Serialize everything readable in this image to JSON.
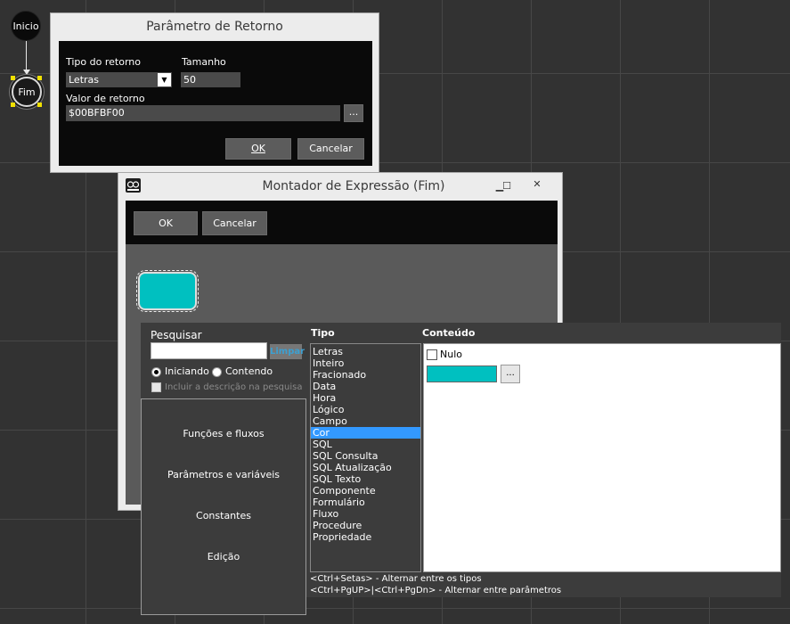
{
  "flow": {
    "start_node": "Inicio",
    "end_node": "Fim"
  },
  "param_dialog": {
    "title": "Parâmetro de Retorno",
    "tipo_label": "Tipo do retorno",
    "tipo_value": "Letras",
    "tamanho_label": "Tamanho",
    "tamanho_value": "50",
    "valor_label": "Valor de retorno",
    "valor_value": "$00BFBF00",
    "browse_label": "...",
    "ok_label": "OK",
    "cancel_label": "Cancelar"
  },
  "expr_window": {
    "title": "Montador de Expressão (Fim)",
    "minimize": "▁",
    "maximize": "☐",
    "close": "✕",
    "ok_label": "OK",
    "cancel_label": "Cancelar",
    "swatch_color": "#00C0C0"
  },
  "search": {
    "label": "Pesquisar",
    "value": "",
    "clear_label": "Limpar",
    "radio_starting": "Iniciando",
    "radio_containing": "Contendo",
    "include_desc": "Incluir a descrição na pesquisa"
  },
  "menu": {
    "items": [
      "Funções e fluxos",
      "Parâmetros e variáveis",
      "Constantes",
      "Edição"
    ]
  },
  "tipo": {
    "header": "Tipo",
    "items": [
      "Letras",
      "Inteiro",
      "Fracionado",
      "Data",
      "Hora",
      "Lógico",
      "Campo",
      "Cor",
      "SQL",
      "SQL Consulta",
      "SQL Atualização",
      "SQL Texto",
      "Componente",
      "Formulário",
      "Fluxo",
      "Procedure",
      "Propriedade"
    ],
    "selected": "Cor"
  },
  "conteudo": {
    "header": "Conteúdo",
    "nulo_label": "Nulo",
    "color_value": "#00C0C0",
    "browse_label": "..."
  },
  "hints": {
    "line1": "<Ctrl+Setas> - Alternar entre os tipos",
    "line2": "<Ctrl+PgUP>|<Ctrl+PgDn> - Alternar entre parâmetros"
  }
}
